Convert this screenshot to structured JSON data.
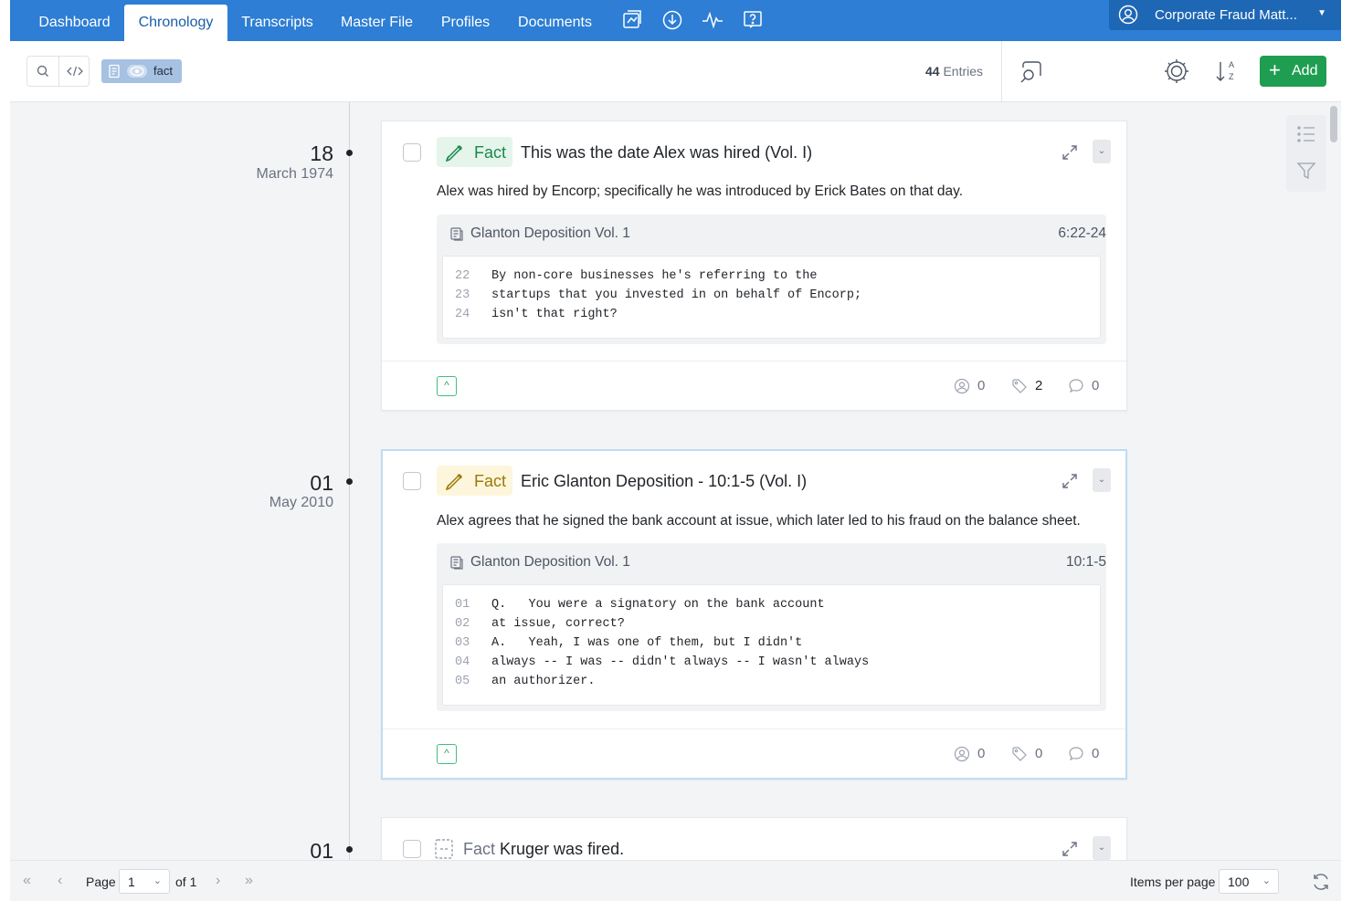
{
  "nav": {
    "tabs": [
      "Dashboard",
      "Chronology",
      "Transcripts",
      "Master File",
      "Profiles",
      "Documents"
    ],
    "active_tab": "Chronology",
    "icons": [
      "export-icon",
      "download-icon",
      "activity-icon",
      "help-icon"
    ],
    "matter_label": "Corporate Fraud Matt..."
  },
  "toolbar": {
    "filter_chip_text": "fact",
    "entries_count": "44",
    "entries_label": "Entries",
    "add_label": "Add"
  },
  "entries": [
    {
      "day": "18",
      "month_year": "March 1974",
      "tag": "Fact",
      "title": "This was the date Alex was hired (Vol. I)",
      "description": "Alex was hired by Encorp; specifically he was introduced by Erick Bates on that day.",
      "source": "Glanton Deposition Vol. 1",
      "ref": "6:22-24",
      "lines": [
        {
          "n": "22",
          "t": "By non-core businesses he's referring to the"
        },
        {
          "n": "23",
          "t": "startups that you invested in on behalf of Encorp;"
        },
        {
          "n": "24",
          "t": "isn't that right?"
        }
      ],
      "people_count": "0",
      "tags_count": "2",
      "comments_count": "0"
    },
    {
      "day": "01",
      "month_year": "May 2010",
      "tag": "Fact",
      "title": "Eric Glanton Deposition - 10:1-5 (Vol. I)",
      "description": "Alex agrees that he signed the bank account at issue, which later led to his fraud on the balance sheet.",
      "source": "Glanton Deposition Vol. 1",
      "ref": "10:1-5",
      "lines": [
        {
          "n": "01",
          "t": "Q.   You were a signatory on the bank account"
        },
        {
          "n": "02",
          "t": "at issue, correct?"
        },
        {
          "n": "03",
          "t": "A.   Yeah, I was one of them, but I didn't"
        },
        {
          "n": "04",
          "t": "always -- I was -- didn't always -- I wasn't always"
        },
        {
          "n": "05",
          "t": "an authorizer."
        }
      ],
      "people_count": "0",
      "tags_count": "0",
      "comments_count": "0"
    },
    {
      "day": "01",
      "tag": "Fact",
      "title": "Kruger was fired."
    }
  ],
  "pager": {
    "page_label": "Page",
    "page_value": "1",
    "of_label": "of 1",
    "items_per_page_label": "Items per page",
    "items_per_page_value": "100"
  },
  "colors": {
    "nav_blue": "#2d7ed4",
    "add_green": "#1f9e52",
    "fact_green": "#1a8a49",
    "fact_yellow": "#9a7a0a"
  }
}
